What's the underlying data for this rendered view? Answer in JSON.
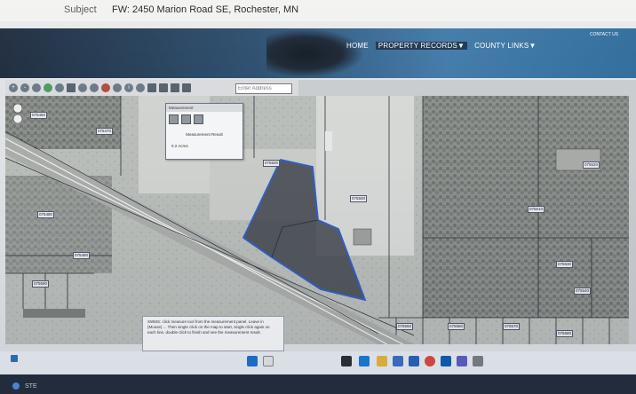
{
  "email": {
    "subject_label": "Subject",
    "subject_value": "FW: 2450 Marion Road SE, Rochester, MN"
  },
  "site": {
    "nav": [
      "HOME",
      "PROPERTY RECORDS▼",
      "COUNTY LINKS▼"
    ],
    "contact": "CONTACT US"
  },
  "map": {
    "address_placeholder": "Enter Address",
    "parcel_labels": [
      "075460",
      "075470",
      "075480",
      "075490",
      "075500",
      "075500",
      "075510",
      "075520",
      "075530",
      "075540",
      "075550",
      "075560",
      "075570",
      "075580",
      "075590"
    ],
    "highlight_color": "#3c4048",
    "outline_color": "#2f5fd0"
  },
  "measure": {
    "title": "Measurement",
    "result_label": "Measurement Result",
    "result_value": "0.2 Acres"
  },
  "help": {
    "text": "SWMS: click measure tool from the measurement panel. Leave in (Mouse) ... Then single click on the map to start, single click again on each line, double click to finish and see the measurement result."
  },
  "taskbar": {
    "apps": [
      "start-icon",
      "search-icon",
      "task-view-icon",
      "browser-icon",
      "file-explorer-icon",
      "store-icon",
      "mail-icon",
      "chrome-icon",
      "outlook-icon",
      "teams-icon",
      "settings-icon"
    ]
  },
  "bezel": {
    "text": "STE"
  }
}
